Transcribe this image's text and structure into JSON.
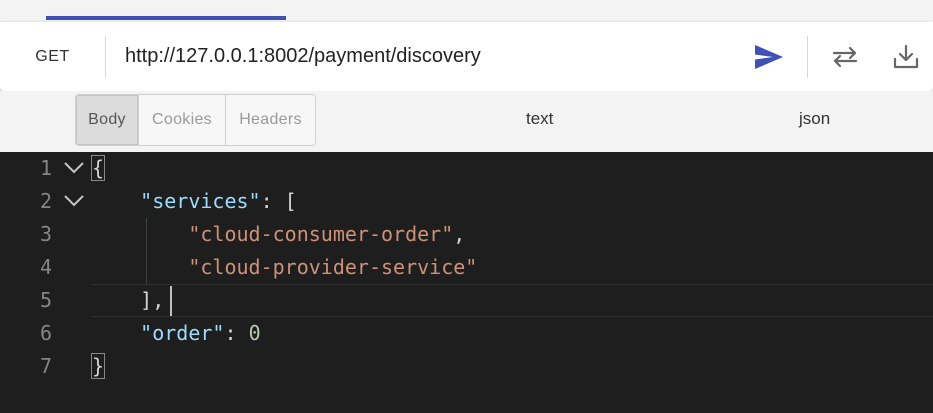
{
  "request": {
    "method": "GET",
    "url": "http://127.0.0.1:8002/payment/discovery"
  },
  "icons": {
    "send": "send-icon",
    "swap": "swap-icon",
    "download": "download-icon",
    "fold": "chevron-down-icon"
  },
  "colors": {
    "accent": "#3f51b5",
    "editor_bg": "#1e1e1e",
    "json_key": "#9cdcfe",
    "json_string": "#ce9178",
    "json_number": "#b5cea8"
  },
  "response": {
    "tabs": [
      {
        "label": "Body",
        "active": true
      },
      {
        "label": "Cookies",
        "active": false
      },
      {
        "label": "Headers",
        "active": false
      }
    ],
    "format_options": [
      "text",
      "json"
    ]
  },
  "editor": {
    "line_numbers": [
      "1",
      "2",
      "3",
      "4",
      "5",
      "6",
      "7"
    ],
    "lines": {
      "l1_open": "{",
      "l2_key": "\"services\"",
      "l2_rest": ": [",
      "l3_str": "\"cloud-consumer-order\"",
      "l3_comma": ",",
      "l4_str": "\"cloud-provider-service\"",
      "l5_close": "],",
      "l6_key": "\"order\"",
      "l6_colon": ": ",
      "l6_num": "0",
      "l7_close": "}"
    }
  }
}
